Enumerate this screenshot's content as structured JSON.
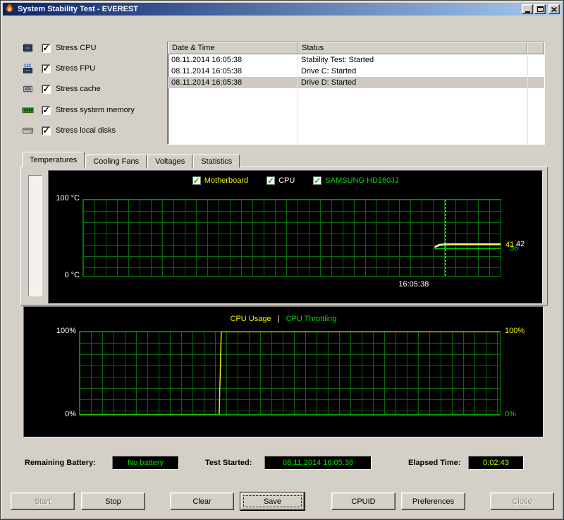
{
  "window": {
    "title": "System Stability Test - EVEREST"
  },
  "icons": {
    "check": "✓"
  },
  "stress_options": [
    {
      "label": "Stress CPU",
      "checked": true,
      "icon": "cpu-chip-icon"
    },
    {
      "label": "Stress FPU",
      "checked": true,
      "icon": "fpu-chip-icon"
    },
    {
      "label": "Stress cache",
      "checked": true,
      "icon": "cache-chip-icon"
    },
    {
      "label": "Stress system memory",
      "checked": true,
      "icon": "memory-module-icon"
    },
    {
      "label": "Stress local disks",
      "checked": true,
      "icon": "hard-disk-icon"
    }
  ],
  "log": {
    "columns": [
      "Date & Time",
      "Status"
    ],
    "rows": [
      {
        "datetime": "08.11.2014 16:05:38",
        "status": "Stability Test: Started",
        "selected": false
      },
      {
        "datetime": "08.11.2014 16:05:38",
        "status": "Drive C: Started",
        "selected": false
      },
      {
        "datetime": "08.11.2014 16:05:38",
        "status": "Drive D: Started",
        "selected": true
      }
    ]
  },
  "tabs": [
    {
      "label": "Temperatures",
      "active": true
    },
    {
      "label": "Cooling Fans",
      "active": false
    },
    {
      "label": "Voltages",
      "active": false
    },
    {
      "label": "Statistics",
      "active": false
    }
  ],
  "chart_data": [
    {
      "type": "line",
      "name": "Temperatures",
      "grid": true,
      "legend_position": "top",
      "ylim": [
        0,
        100
      ],
      "ylabel_top": "100 °C",
      "ylabel_bottom": "0 °C",
      "legend": [
        {
          "label": "Motherboard",
          "color": "#f4f400",
          "checked": true
        },
        {
          "label": "CPU",
          "color": "#ffffff",
          "checked": true
        },
        {
          "label": "SAMSUNG HD160JJ",
          "color": "#00d800",
          "checked": true
        }
      ],
      "time_marker": {
        "x": 0.866,
        "label": "16:05:38"
      },
      "series": [
        {
          "name": "Motherboard",
          "color": "#f4f400",
          "value_label": "41",
          "points": [
            [
              0.842,
              37
            ],
            [
              0.852,
              39.5
            ],
            [
              0.864,
              40.5
            ],
            [
              0.885,
              41
            ],
            [
              1,
              41
            ]
          ]
        },
        {
          "name": "CPU",
          "color": "#ffffff",
          "value_label": "42",
          "points": [
            [
              0.842,
              38
            ],
            [
              0.852,
              41
            ],
            [
              0.864,
              42
            ],
            [
              1,
              42
            ]
          ]
        },
        {
          "name": "SAMSUNG HD160JJ",
          "color": "#00d800",
          "value_label": "36",
          "points": [
            [
              0.842,
              35.5
            ],
            [
              0.87,
              36
            ],
            [
              1,
              36
            ]
          ]
        }
      ]
    },
    {
      "type": "line",
      "name": "CPU Usage",
      "grid": true,
      "ylim": [
        0,
        100
      ],
      "title_parts": [
        {
          "text": "CPU Usage",
          "color": "#f4f400"
        },
        {
          "text": "|",
          "color": "#ffffff"
        },
        {
          "text": "CPU Throttling",
          "color": "#00d800"
        }
      ],
      "left_labels": [
        {
          "text": "100%",
          "color": "#ffffff"
        },
        {
          "text": "0%",
          "color": "#ffffff"
        }
      ],
      "right_labels": [
        {
          "text": "100%",
          "color": "#f4f400"
        },
        {
          "text": "0%",
          "color": "#00d800"
        }
      ],
      "series": [
        {
          "name": "CPU Usage",
          "color": "#f4f400",
          "points": [
            [
              0,
              0
            ],
            [
              0.332,
              0
            ],
            [
              0.337,
              100
            ],
            [
              1,
              100
            ]
          ]
        },
        {
          "name": "CPU Throttling",
          "color": "#00d800",
          "points": [
            [
              0,
              0
            ],
            [
              1,
              0
            ]
          ]
        }
      ]
    }
  ],
  "status_bar": {
    "battery_label": "Remaining Battery:",
    "battery_value": "No battery",
    "battery_color": "#00dd00",
    "started_label": "Test Started:",
    "started_value": "08.11.2014 16:05:38",
    "started_color": "#00dd00",
    "elapsed_label": "Elapsed Time:",
    "elapsed_value": "0:02:43",
    "elapsed_color": "#b8ff00"
  },
  "buttons": [
    {
      "label": "Start",
      "enabled": false
    },
    {
      "label": "Stop",
      "enabled": true
    },
    {
      "label": "Clear",
      "enabled": true
    },
    {
      "label": "Save",
      "enabled": true,
      "default": true
    },
    {
      "label": "CPUID",
      "enabled": true
    },
    {
      "label": "Preferences",
      "enabled": true
    },
    {
      "label": "Close",
      "enabled": false
    }
  ]
}
